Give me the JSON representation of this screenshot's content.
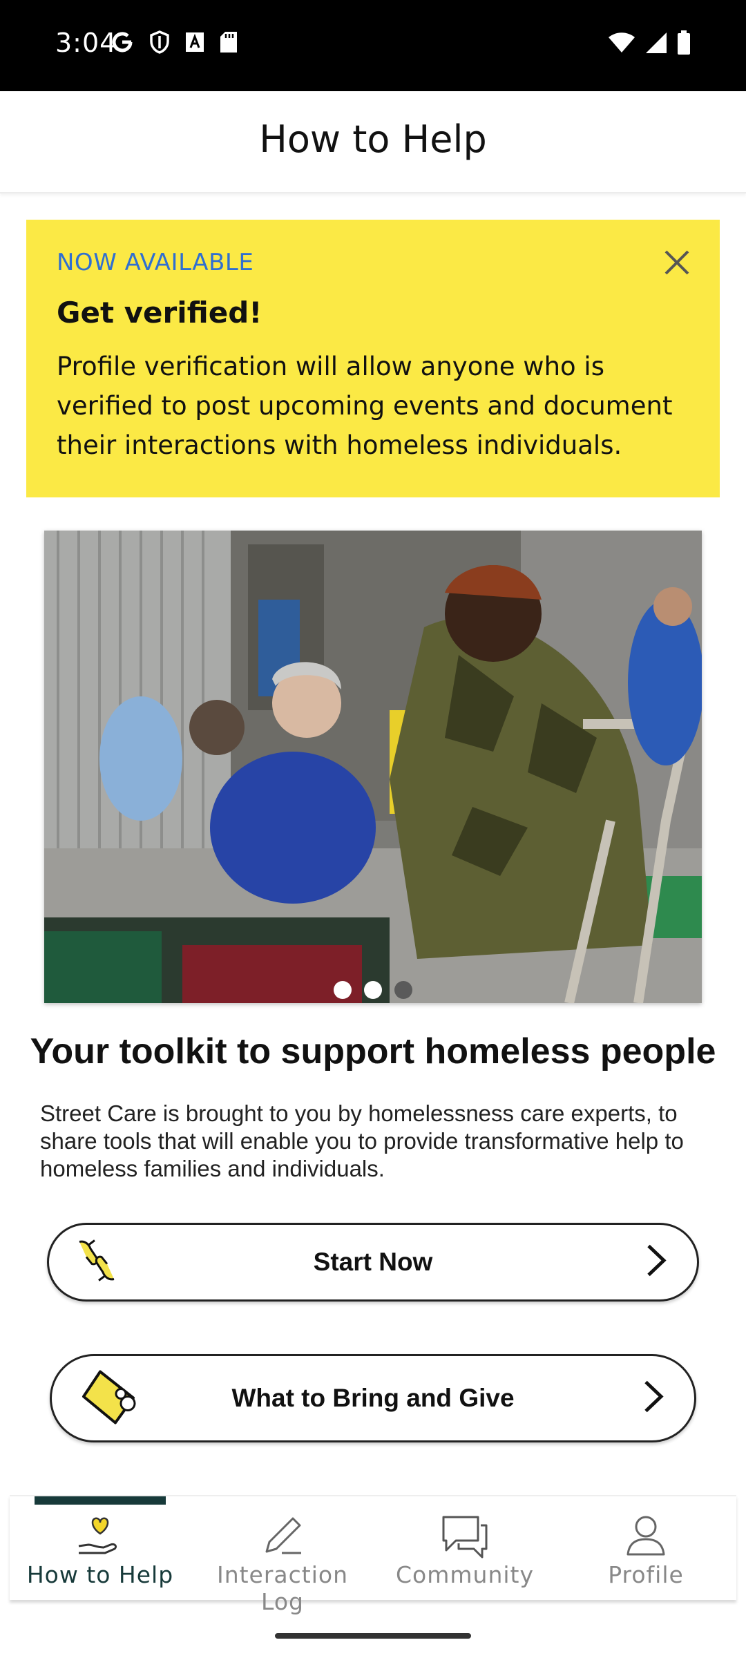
{
  "status_bar": {
    "time": "3:04",
    "left_icons": [
      "google-icon",
      "shield-icon",
      "text-icon",
      "sd-card-icon"
    ],
    "right_icons": [
      "wifi-icon",
      "signal-icon",
      "battery-icon"
    ]
  },
  "header": {
    "title": "How to Help"
  },
  "banner": {
    "eyebrow": "NOW AVAILABLE",
    "heading": "Get verified!",
    "body": "Profile verification will allow anyone who is verified to post upcoming events and document their interactions with homeless individuals.",
    "close_icon": "close-icon",
    "background": "#fbe945",
    "eyebrow_color": "#2f6fd1"
  },
  "carousel": {
    "slide_count": 3,
    "active_index": 1
  },
  "content": {
    "title": "Your toolkit to support homeless people",
    "description": "Street Care is brought to you by homelessness care experts, to share tools that will enable you to provide transformative help to homeless families and individuals."
  },
  "actions": {
    "start_now": {
      "label": "Start Now",
      "icon": "helping-hands-icon"
    },
    "what_to_bring": {
      "label": "What to Bring and Give",
      "icon": "soap-icon"
    }
  },
  "nav": {
    "items": [
      {
        "label": "How to Help",
        "icon": "heart-hand-icon",
        "active": true
      },
      {
        "label": "Interaction Log",
        "icon": "pencil-icon",
        "active": false
      },
      {
        "label": "Community",
        "icon": "chat-icon",
        "active": false
      },
      {
        "label": "Profile",
        "icon": "person-icon",
        "active": false
      }
    ],
    "accent": "#173a3a"
  }
}
